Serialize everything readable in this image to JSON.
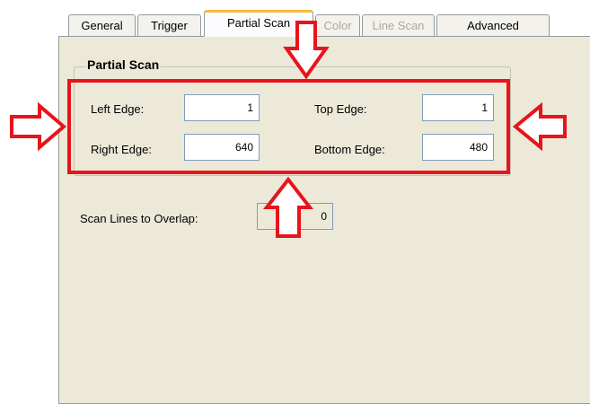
{
  "tabs": [
    {
      "label": "General",
      "state": "normal"
    },
    {
      "label": "Trigger",
      "state": "normal"
    },
    {
      "label": "Partial Scan",
      "state": "active"
    },
    {
      "label": "Color",
      "state": "disabled"
    },
    {
      "label": "Line Scan",
      "state": "disabled"
    },
    {
      "label": "Advanced",
      "state": "normal"
    }
  ],
  "partial_scan": {
    "group_title": "Partial Scan",
    "left_edge_label": "Left Edge:",
    "left_edge_value": "1",
    "top_edge_label": "Top Edge:",
    "top_edge_value": "1",
    "right_edge_label": "Right Edge:",
    "right_edge_value": "640",
    "bottom_edge_label": "Bottom Edge:",
    "bottom_edge_value": "480"
  },
  "overlap": {
    "label": "Scan Lines to Overlap:",
    "value": "0"
  },
  "colors": {
    "annotation": "#e8141b",
    "active_tab_accent": "#f9b93c",
    "dialog_face": "#ece9d8"
  },
  "annotation_icons": [
    "arrow-down-icon",
    "arrow-up-icon",
    "arrow-right-icon",
    "arrow-left-icon"
  ]
}
